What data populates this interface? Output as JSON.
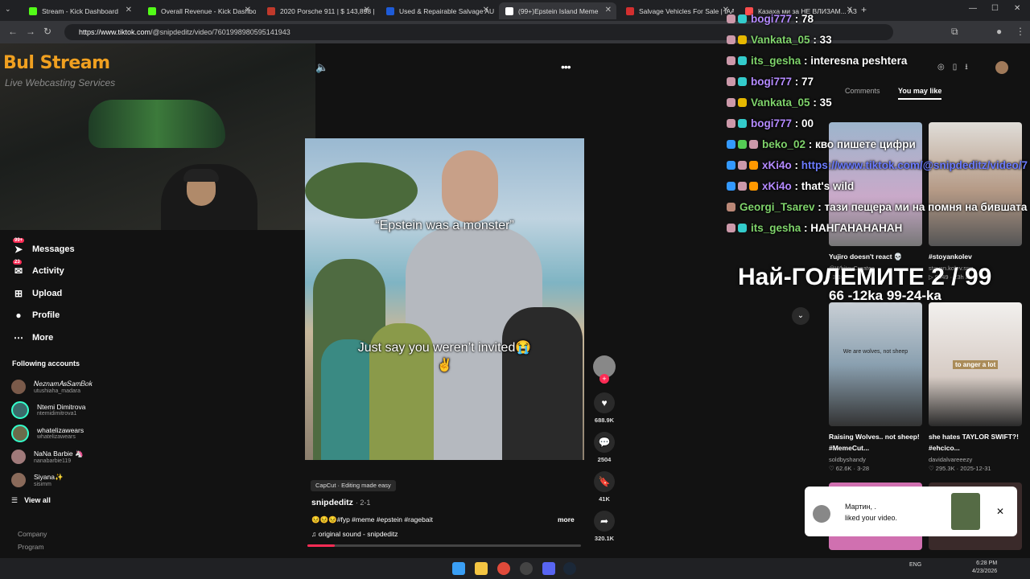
{
  "browser": {
    "tabs": [
      {
        "title": "Stream - Kick Dashboard",
        "color": "#53fc18"
      },
      {
        "title": "Overall Revenue - Kick Dashbo",
        "color": "#53fc18"
      },
      {
        "title": "2020 Porsche 911 | $ 143,898 |",
        "color": "#c0392b"
      },
      {
        "title": "Used & Repairable Salvage AUT",
        "color": "#1e5bd8"
      },
      {
        "title": "(99+)Epstein Island Meme",
        "color": "#ffffff"
      },
      {
        "title": "Salvage Vehicles For Sale | IAA",
        "color": "#d32f2f"
      },
      {
        "title": "Казаха ми за НЕ ВЛИЗАМ... АЗ",
        "color": "#ff4d4d"
      }
    ],
    "url_host": "https://www.tiktok.com",
    "url_path": "/@snipdeditz/video/7601998980595141943"
  },
  "stream_overlay": {
    "logo": "Bul Stream",
    "logo_sub": "Live Webcasting Services",
    "big_text": "Най-ГОЛЕМИТЕ 2 / 99",
    "sub_text": "66 -12ka 99-24-ka"
  },
  "sidebar": {
    "items": [
      {
        "label": "Messages",
        "icon": "paper-plane-icon",
        "badge": "99+"
      },
      {
        "label": "Activity",
        "icon": "inbox-icon",
        "badge": "23"
      },
      {
        "label": "Upload",
        "icon": "plus-square-icon",
        "badge": ""
      },
      {
        "label": "Profile",
        "icon": "avatar-icon",
        "badge": ""
      },
      {
        "label": "More",
        "icon": "more-dots-icon",
        "badge": ""
      }
    ],
    "following_title": "Following accounts",
    "following": [
      {
        "name": "𝑁𝑒𝑧𝑛𝑎𝑚𝐴𝑠𝑆𝑎𝑚𝐵𝑜𝑘",
        "handle": "utushiaha_madara"
      },
      {
        "name": "Ntemi Dimitrova",
        "handle": "ntemidimitrova1"
      },
      {
        "name": "whatelizawears",
        "handle": "whatelizawears"
      },
      {
        "name": "NaNa Barbie 🦄",
        "handle": "nanabarbie119"
      },
      {
        "name": "Siyana✨",
        "handle": "sisimm"
      }
    ],
    "view_all": "View all",
    "footer": [
      "Company",
      "Program"
    ]
  },
  "video": {
    "caption_top": "“Epstein was a monster”",
    "caption_bottom": "Just say you weren’t invited😭✌️",
    "capcut": "CapCut · Editing made easy",
    "author": "snipdeditz",
    "date": "· 2-1",
    "description": "😣😣😣#fyp #meme #epstein #ragebait",
    "more": "more",
    "sound": "original sound - snipdeditz",
    "progress": 0.1,
    "likes": "688.9K",
    "comments": "2504",
    "saves": "41K",
    "shares": "320.1K"
  },
  "right_panel": {
    "tabs": [
      "Comments",
      "You may like"
    ],
    "thumbs": [
      {
        "caption": "Yujiro doesn't react 💀",
        "meta": "@WhiteyCreates",
        "meta2": "· 3-10",
        "color": "#8fa8c0"
      },
      {
        "caption": "#stoyankolev",
        "meta": "stoyan.kolev.sng",
        "meta2": "▷ 9449 · 23h ago",
        "color": "#c9b7a6"
      },
      {
        "caption": "Raising Wolves.. not sheep! #MemeCut...",
        "meta": "soldbyshandy",
        "meta2": "♡ 62.6K · 3-28",
        "color": "#aab4bd"
      },
      {
        "caption": "she hates TAYLOR SWIFT?! #ehcico...",
        "meta": "davidalvareeezy",
        "meta2": "♡ 295.3K · 2025-12-31",
        "color": "#d9d2cc"
      }
    ],
    "thumb_texts": [
      "to anger a lot",
      "We are wolves, not sheep"
    ]
  },
  "chat": [
    {
      "user": "bogi777",
      "msg": "78",
      "color": "#b48aff"
    },
    {
      "user": "Vankata_05",
      "msg": "33",
      "color": "#7fd36b"
    },
    {
      "user": "its_gesha",
      "msg": "interesna peshtera",
      "color": "#7fd36b"
    },
    {
      "user": "bogi777",
      "msg": "77",
      "color": "#b48aff"
    },
    {
      "user": "Vankata_05",
      "msg": "35",
      "color": "#7fd36b"
    },
    {
      "user": "bogi777",
      "msg": "00",
      "color": "#b48aff"
    },
    {
      "user": "beko_02",
      "msg": "кво пишете цифри",
      "color": "#7fd36b"
    },
    {
      "user": "xKi4o",
      "msg": "https://www.tiktok.com/@snipdeditz/video/7",
      "color": "#b48aff"
    },
    {
      "user": "xKi4o",
      "msg": "that's wild",
      "color": "#b48aff"
    },
    {
      "user": "Georgi_Tsarev",
      "msg": "тази пещера ми на помня на бившата",
      "color": "#7fd36b"
    },
    {
      "user": "its_gesha",
      "msg": "НАНГАНАНАНАН",
      "color": "#7fd36b"
    }
  ],
  "notification": {
    "name": "Мартин, .",
    "text": "liked your video."
  },
  "taskbar": {
    "lang": "ENG",
    "time": "6:28 PM",
    "date": "4/23/2026"
  }
}
